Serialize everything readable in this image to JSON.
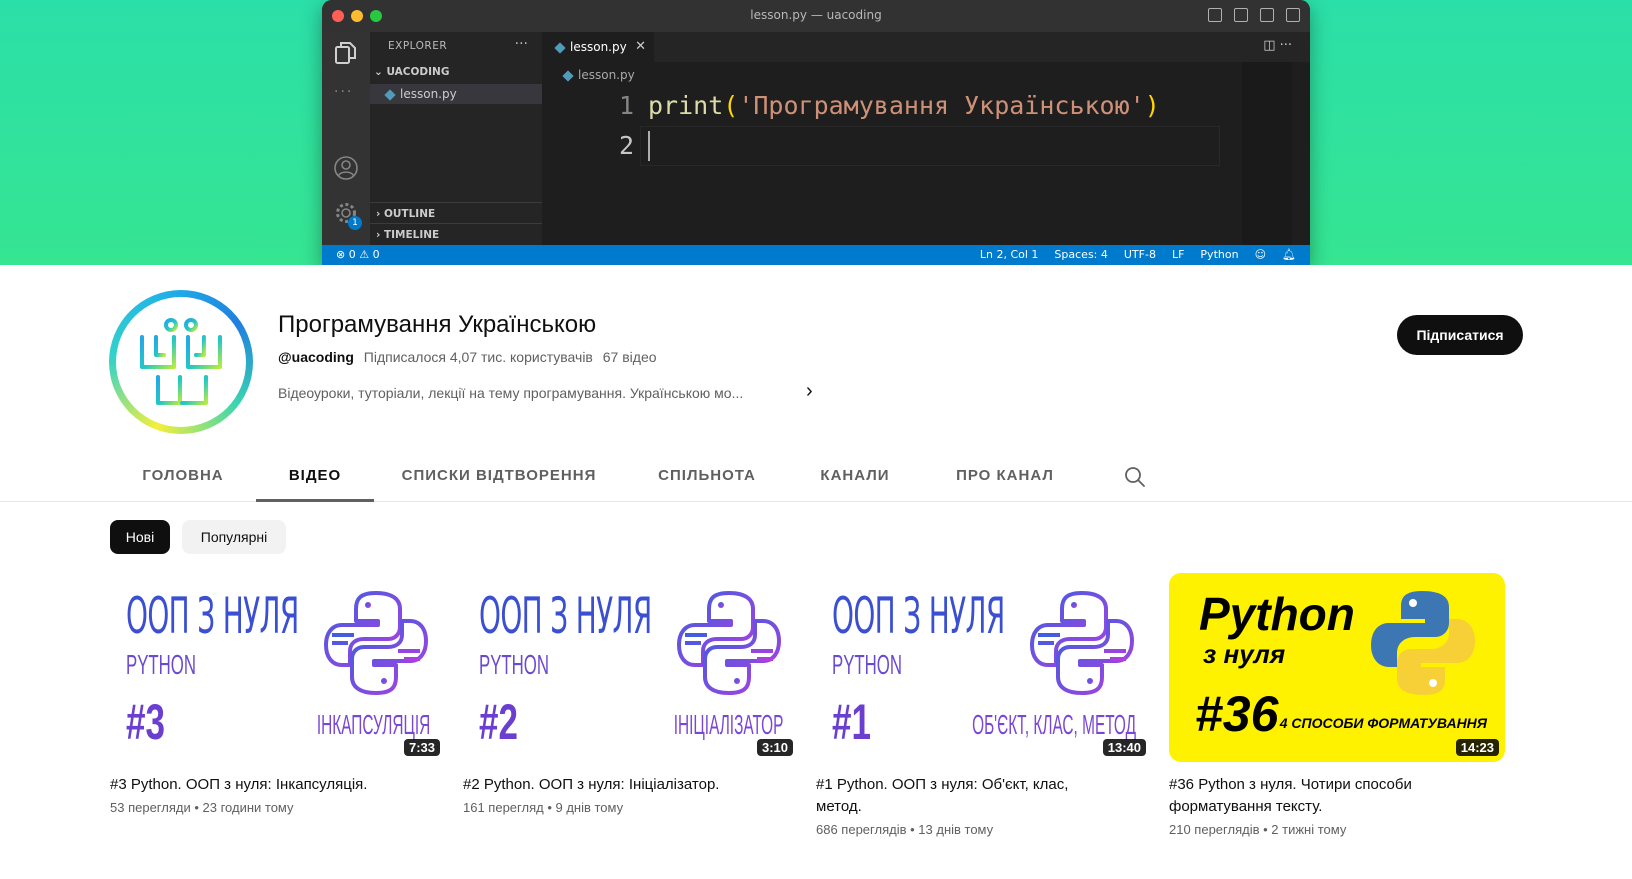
{
  "banner": {
    "window_title": "lesson.py — uacoding",
    "explorer_label": "EXPLORER",
    "folder_name": "UACODING",
    "file_name": "lesson.py",
    "outline_label": "OUTLINE",
    "timeline_label": "TIMELINE",
    "tab_label": "lesson.py",
    "breadcrumb": "lesson.py",
    "line_numbers": [
      "1",
      "2"
    ],
    "code_fn": "print",
    "code_open": "(",
    "code_string": "'Програмування Українською'",
    "code_close": ")",
    "badge": "1",
    "status_left": "⊗ 0 ⚠ 0",
    "status_items": [
      "Ln 2, Col 1",
      "Spaces: 4",
      "UTF-8",
      "LF",
      "Python"
    ]
  },
  "channel": {
    "name": "Програмування Українською",
    "handle": "@uacoding",
    "subscribers": "Підписалося 4,07 тис. користувачів",
    "video_count": "67 відео",
    "description": "Відеоуроки, туторіали, лекції на тему програмування. Українською мо...",
    "subscribe_label": "Підписатися"
  },
  "nav": {
    "tabs": [
      "ГОЛОВНА",
      "ВІДЕО",
      "СПИСКИ ВІДТВОРЕННЯ",
      "СПІЛЬНОТА",
      "КАНАЛИ",
      "ПРО КАНАЛ"
    ],
    "active": "ВІДЕО"
  },
  "chips": {
    "new": "Нові",
    "popular": "Популярні"
  },
  "videos": [
    {
      "title": "#3 Python. ООП з нуля: Інкапсуляція.",
      "views": "53 перегляди",
      "age": "23 години тому",
      "duration": "7:33",
      "thumb": {
        "headline": "ООП З НУЛЯ",
        "lang": "PYTHON",
        "num": "#3",
        "topic": "ІНКАПСУЛЯЦІЯ"
      }
    },
    {
      "title": "#2 Python. ООП з нуля: Ініціалізатор.",
      "views": "161 перегляд",
      "age": "9 днів тому",
      "duration": "3:10",
      "thumb": {
        "headline": "ООП З НУЛЯ",
        "lang": "PYTHON",
        "num": "#2",
        "topic": "ІНІЦІАЛІЗАТОР"
      }
    },
    {
      "title": "#1 Python. ООП з нуля: Об'єкт, клас, метод.",
      "views": "686 переглядів",
      "age": "13 днів тому",
      "duration": "13:40",
      "thumb": {
        "headline": "ООП З НУЛЯ",
        "lang": "PYTHON",
        "num": "#1",
        "topic": "ОБ'ЄКТ, КЛАС, МЕТОД"
      }
    },
    {
      "title": "#36 Python з нуля. Чотири способи форматування тексту.",
      "views": "210 переглядів",
      "age": "2 тижні тому",
      "duration": "14:23",
      "thumb": {
        "headline": "Python",
        "sub": "з нуля",
        "num": "#36",
        "caption": "4 СПОСОБИ ФОРМАТУВАННЯ"
      }
    }
  ],
  "colors": {
    "banner_bg": "#2ee0a0",
    "statusbar": "#007acc",
    "subscribe_bg": "#0f0f0f",
    "thumb_purple": "#6a3fd0",
    "thumb_yellow": "#fff200"
  },
  "icons": {
    "explorer": "files-icon",
    "account": "account-icon",
    "settings": "gear-icon",
    "search": "search-icon",
    "more": "chevron-right-icon"
  }
}
